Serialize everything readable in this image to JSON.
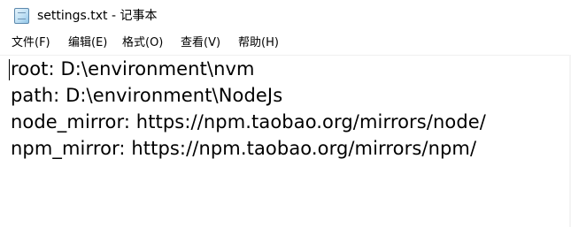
{
  "window": {
    "title": "settings.txt - 记事本"
  },
  "icons": {
    "app": "notepad-icon"
  },
  "menu": {
    "file": "文件(F)",
    "edit": "编辑(E)",
    "format": "格式(O)",
    "view": "查看(V)",
    "help": "帮助(H)"
  },
  "editor": {
    "lines": [
      "root: D:\\environment\\nvm",
      "path: D:\\environment\\NodeJs",
      "node_mirror: https://npm.taobao.org/mirrors/node/",
      "npm_mirror: https://npm.taobao.org/mirrors/npm/"
    ]
  }
}
